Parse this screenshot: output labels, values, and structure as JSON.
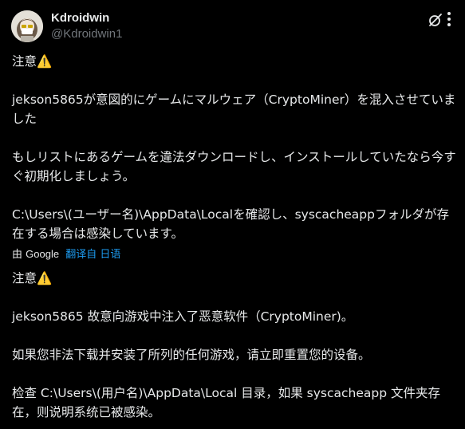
{
  "author": {
    "display_name": "Kdroidwin",
    "handle": "@Kdroidwin1"
  },
  "icons": {
    "grok": "grok-slash-icon",
    "more": "more-dots-icon"
  },
  "post": {
    "original_text": "注意⚠️\n\njekson5865が意図的にゲームにマルウェア（CryptoMiner）を混入させていました\n\nもしリストにあるゲームを違法ダウンロードし、インストールしていたなら今すぐ初期化しましょう。\n\nC:\\Users\\(ユーザー名)\\AppData\\Localを確認し、syscacheappフォルダが存在する場合は感染しています。",
    "translated_text": "注意⚠️\n\njekson5865 故意向游戏中注入了恶意软件（CryptoMiner)。\n\n如果您非法下载并安装了所列的任何游戏，请立即重置您的设备。\n\n检查 C:\\Users\\(用户名)\\AppData\\Local 目录，如果 syscacheapp 文件夹存在，则说明系统已被感染。"
  },
  "translation_bar": {
    "by_label": "由",
    "provider": "Google",
    "link_label": "翻译自 日语"
  },
  "colors": {
    "background": "#000000",
    "text": "#e7e9ea",
    "secondary": "#71767b",
    "link": "#1d9bf0"
  }
}
